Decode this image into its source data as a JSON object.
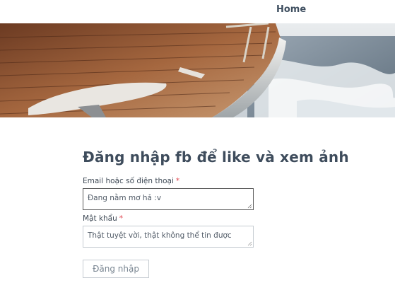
{
  "nav": {
    "home_label": "Home"
  },
  "hero": {
    "image": "boat-deck-ocean-photo"
  },
  "form": {
    "title": "Đăng nhập fb để like và xem ảnh",
    "email": {
      "label": "Email hoặc số điện thoại",
      "required_mark": "*",
      "value": "Đang nằm mơ hả :v"
    },
    "password": {
      "label": "Mật khẩu",
      "required_mark": "*",
      "value": "Thật tuyệt vời, thật không thể tin được"
    },
    "submit_label": "Đăng nhập"
  },
  "colors": {
    "required": "#e0464f",
    "title": "#3e4c5c",
    "border": "#c6ccd2"
  }
}
